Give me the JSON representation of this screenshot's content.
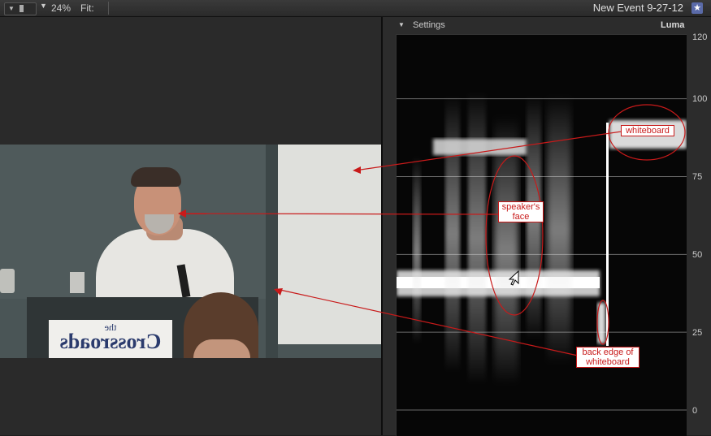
{
  "toolbar": {
    "zoom_value": "24%",
    "fit_label": "Fit:",
    "event_title": "New Event 9-27-12",
    "star_icon": "star-icon",
    "toggle_icon": "viewer-toggle-icon",
    "chevron_icon": "chevron-down-icon"
  },
  "scope": {
    "settings_label": "Settings",
    "mode_label": "Luma",
    "axis_ticks": [
      "120",
      "100",
      "75",
      "50",
      "25",
      "0"
    ],
    "grid_lines": [
      100,
      75,
      50,
      25,
      0
    ]
  },
  "annotations": {
    "whiteboard": "whiteboard",
    "face_line1": "speaker's",
    "face_line2": "face",
    "edge_line1": "back edge of",
    "edge_line2": "whiteboard"
  },
  "photo": {
    "sign_small": "the",
    "sign_large": "Crossroads"
  },
  "colors": {
    "annotation_red": "#c81a1a",
    "panel_bg": "#2c2c2c",
    "scope_bg": "#060606"
  }
}
